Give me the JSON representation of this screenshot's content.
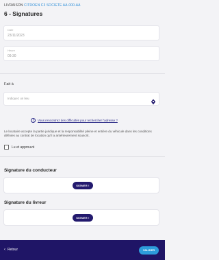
{
  "header": {
    "breadcrumb_prefix": "LIVRAISON",
    "breadcrumb_highlight": "CITROEN C3 SOCIETE AA-000-AA",
    "title": "6 - Signatures"
  },
  "fields": {
    "date": {
      "label": "Date",
      "value": "23/11/2023"
    },
    "time": {
      "label": "Heure",
      "value": "09:30"
    }
  },
  "place": {
    "label": "Fait à",
    "placeholder": "Indiquez un lieu",
    "icon": "map-pin-icon"
  },
  "address_help": {
    "text": "Vous rencontrez des difficultés pour rechercher l'adresse ?"
  },
  "legal_text": "Le locataire accepte la partie juridique et la responsabilité pleine et entière du véhicule dans les conditions définies au contrat de location qu'il a antérieurement souscrit.",
  "consent": {
    "label": "Lu et approuvé",
    "checked": false
  },
  "signatures": {
    "driver": {
      "title": "Signature du conducteur",
      "button": "SIGNER !"
    },
    "deliverer": {
      "title": "Signature du livreur",
      "button": "SIGNER !"
    }
  },
  "footer": {
    "back_label": "Retour",
    "validate_label": "VALIDER"
  },
  "colors": {
    "primary": "#1f1566",
    "accent": "#2d9cdb",
    "link": "#2a2a88"
  }
}
